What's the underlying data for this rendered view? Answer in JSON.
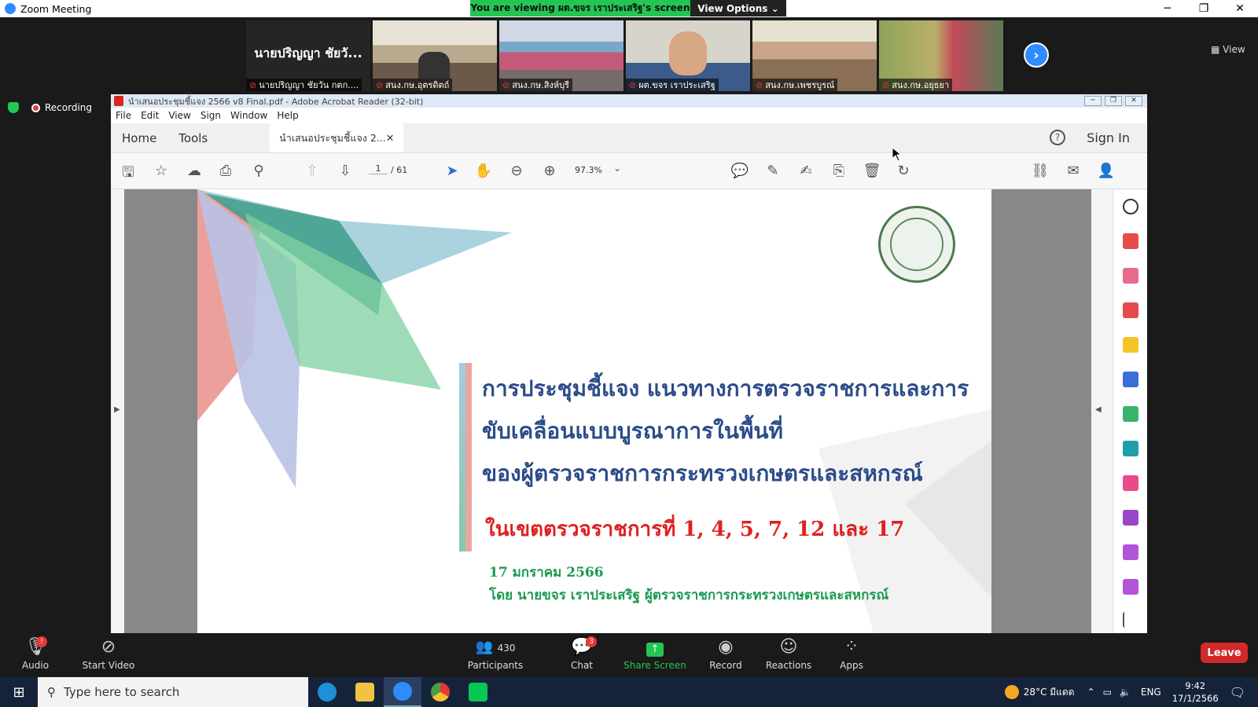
{
  "zoom": {
    "window_title": "Zoom Meeting",
    "banner": "You are viewing ผต.ขจร เราประเสริฐ's screen",
    "view_options": "View Options",
    "view_label": "View",
    "recording": "Recording",
    "participants_strip": [
      {
        "name": "นายปริญญา ชัยวัน กตก....",
        "big": "นายปริญญา ชัยวั..."
      },
      {
        "name": "สนง.กษ.อุตรดิตถ์"
      },
      {
        "name": "สนง.กษ.สิงห์บุรี"
      },
      {
        "name": "ผต.ขจร เราประเสริฐ"
      },
      {
        "name": "สนง.กษ.เพชรบูรณ์"
      },
      {
        "name": "สนง.กษ.อยุธยา"
      }
    ]
  },
  "acrobat": {
    "title": "นำเสนอประชุมชี้แจง 2566 v8 Final.pdf - Adobe Acrobat Reader (32-bit)",
    "menu": [
      "File",
      "Edit",
      "View",
      "Sign",
      "Window",
      "Help"
    ],
    "tabs": {
      "home": "Home",
      "tools": "Tools",
      "doc": "นำเสนอประชุมชี้แจง 2..."
    },
    "sign_in": "Sign In",
    "page_current": "1",
    "page_total": "/ 61",
    "zoom": "97.3%"
  },
  "slide": {
    "title_line1": "การประชุมชี้แจง แนวทางการตรวจราชการและการ",
    "title_line2": "ขับเคลื่อนแบบบูรณาการในพื้นที่",
    "title_line3": "ของผู้ตรวจราชการกระทรวงเกษตรและสหกรณ์",
    "zone": "ในเขตตรวจราชการที่ 1, 4, 5, 7, 12 และ 17",
    "date": "17 มกราคม 2566",
    "byline": "โดย นายขจร เราประเสริฐ ผู้ตรวจราชการกระทรวงเกษตรและสหกรณ์"
  },
  "controls": {
    "audio": "Audio",
    "start_video": "Start Video",
    "participants_count": "430",
    "participants": "Participants",
    "chat": "Chat",
    "chat_badge": "3",
    "audio_badge": "!",
    "share": "Share Screen",
    "record": "Record",
    "reactions": "Reactions",
    "apps": "Apps",
    "leave": "Leave"
  },
  "taskbar": {
    "search_placeholder": "Type here to search",
    "weather": "28°C มีแดด",
    "lang": "ENG",
    "time": "9:42",
    "date": "17/1/2566"
  },
  "colors": {
    "zoom_blue": "#2d8cff",
    "banner_green": "#23c553",
    "leave_red": "#d32929",
    "slide_title": "#2b4c8a",
    "slide_red": "#e02020",
    "slide_green": "#1a9a50"
  }
}
